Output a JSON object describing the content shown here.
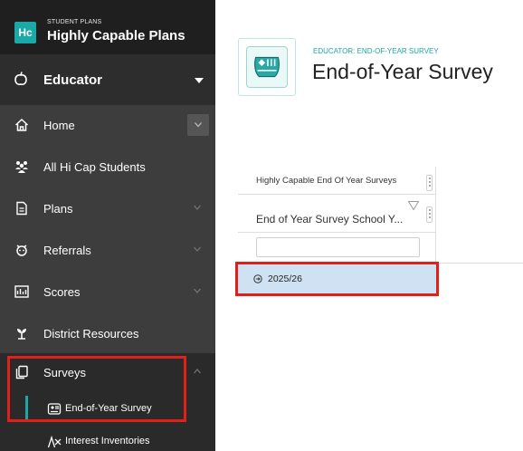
{
  "brand": {
    "badge": "Hc",
    "subtitle": "STUDENT PLANS",
    "title": "Highly Capable Plans"
  },
  "role": {
    "label": "Educator"
  },
  "nav": [
    {
      "label": "Home",
      "icon": "home-icon"
    },
    {
      "label": "All Hi Cap Students",
      "icon": "students-icon"
    },
    {
      "label": "Plans",
      "icon": "document-icon"
    },
    {
      "label": "Referrals",
      "icon": "referrals-icon"
    },
    {
      "label": "Scores",
      "icon": "scores-icon"
    },
    {
      "label": "District Resources",
      "icon": "resources-icon"
    },
    {
      "label": "Surveys",
      "icon": "surveys-icon"
    }
  ],
  "surveys_sub": [
    {
      "label": "End-of-Year Survey",
      "icon": "end-of-year-survey-icon"
    },
    {
      "label": "Interest Inventories",
      "icon": "interest-inventories-icon"
    }
  ],
  "header": {
    "subtitle": "EDUCATOR: END-OF-YEAR SURVEY",
    "title": "End-of-Year Survey"
  },
  "grid": {
    "group_header": "Highly Capable End Of Year Surveys",
    "column_header": "End of Year Survey School Y...",
    "filter_value": "",
    "rows": [
      {
        "label": "2025/26"
      }
    ]
  },
  "colors": {
    "accent": "#1aa9a6",
    "highlight": "#e0201b",
    "sidebar": "#3d3d3d",
    "selected_row": "#cfe2f3"
  }
}
